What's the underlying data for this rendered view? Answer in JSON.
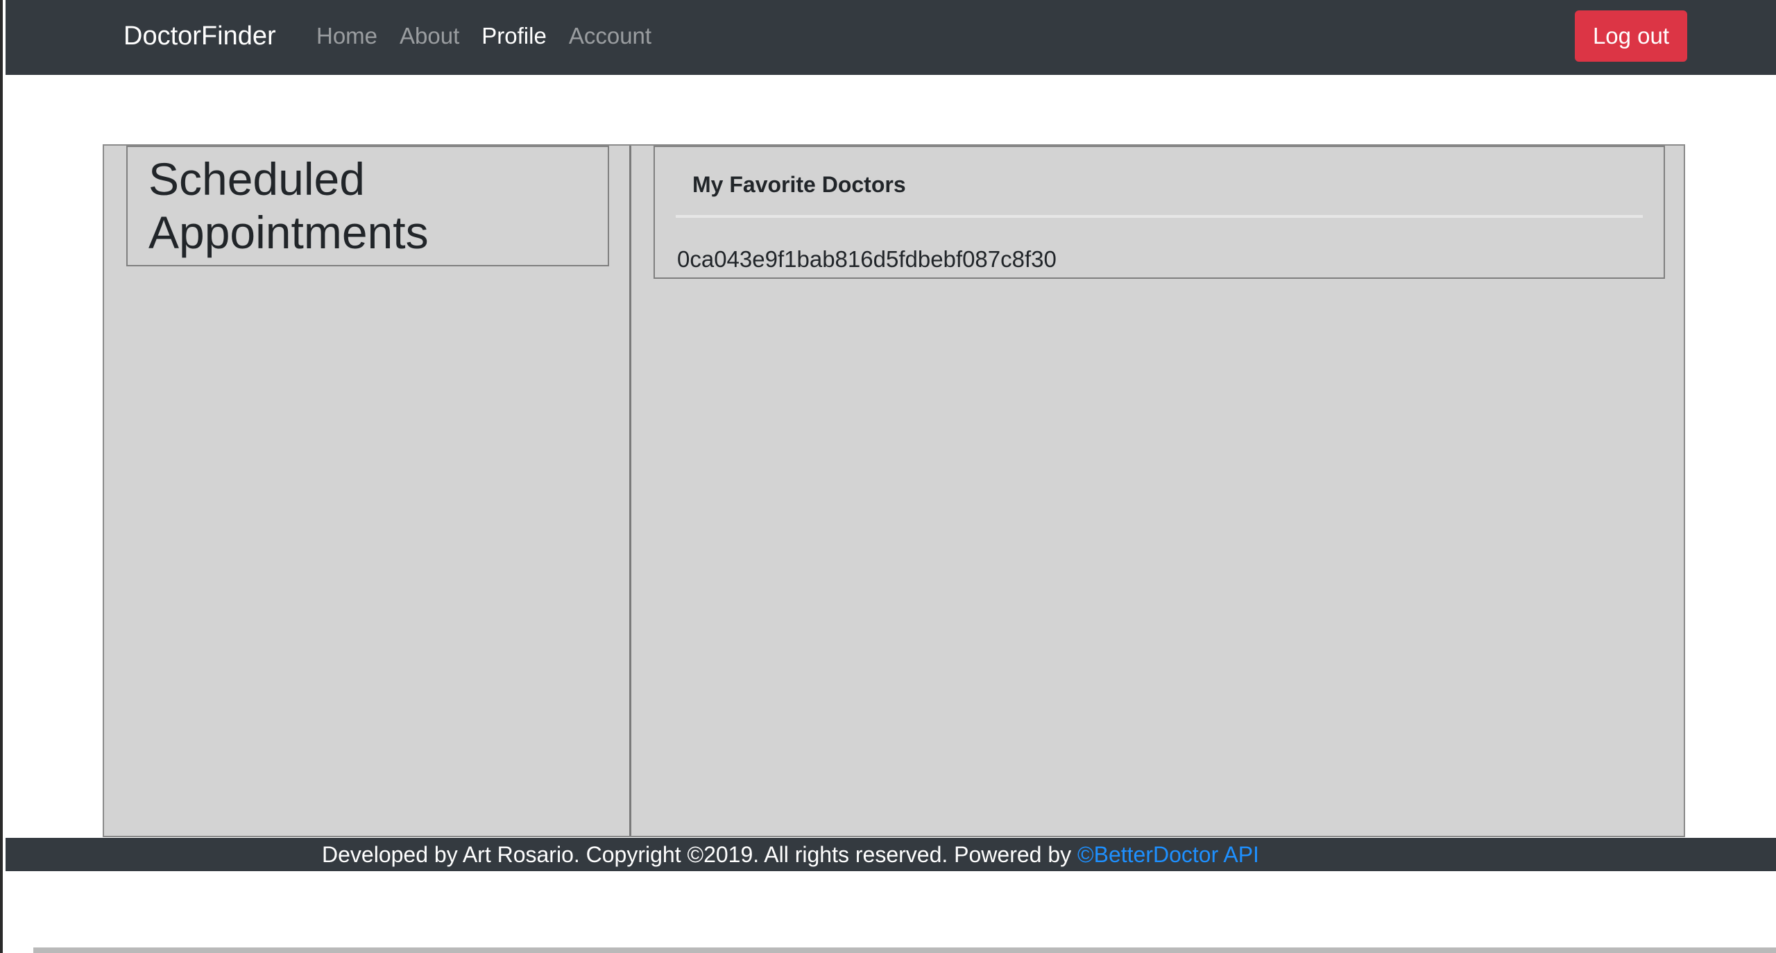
{
  "navbar": {
    "brand": "DoctorFinder",
    "links": [
      {
        "label": "Home",
        "active": false
      },
      {
        "label": "About",
        "active": false
      },
      {
        "label": "Profile",
        "active": true
      },
      {
        "label": "Account",
        "active": false
      }
    ],
    "logout_label": "Log out"
  },
  "appointments": {
    "title": "Scheduled Appointments"
  },
  "favorites": {
    "title": "My Favorite Doctors",
    "items": [
      "0ca043e9f1bab816d5fdbebf087c8f30"
    ]
  },
  "footer": {
    "text": "Developed by Art Rosario. Copyright ©2019. All rights reserved. Powered by ",
    "link_label": "©BetterDoctor API"
  },
  "colors": {
    "navbar_bg": "#343a40",
    "logout_bg": "#dc3545",
    "panel_bg": "#d3d3d3",
    "link": "#1e90ff"
  }
}
